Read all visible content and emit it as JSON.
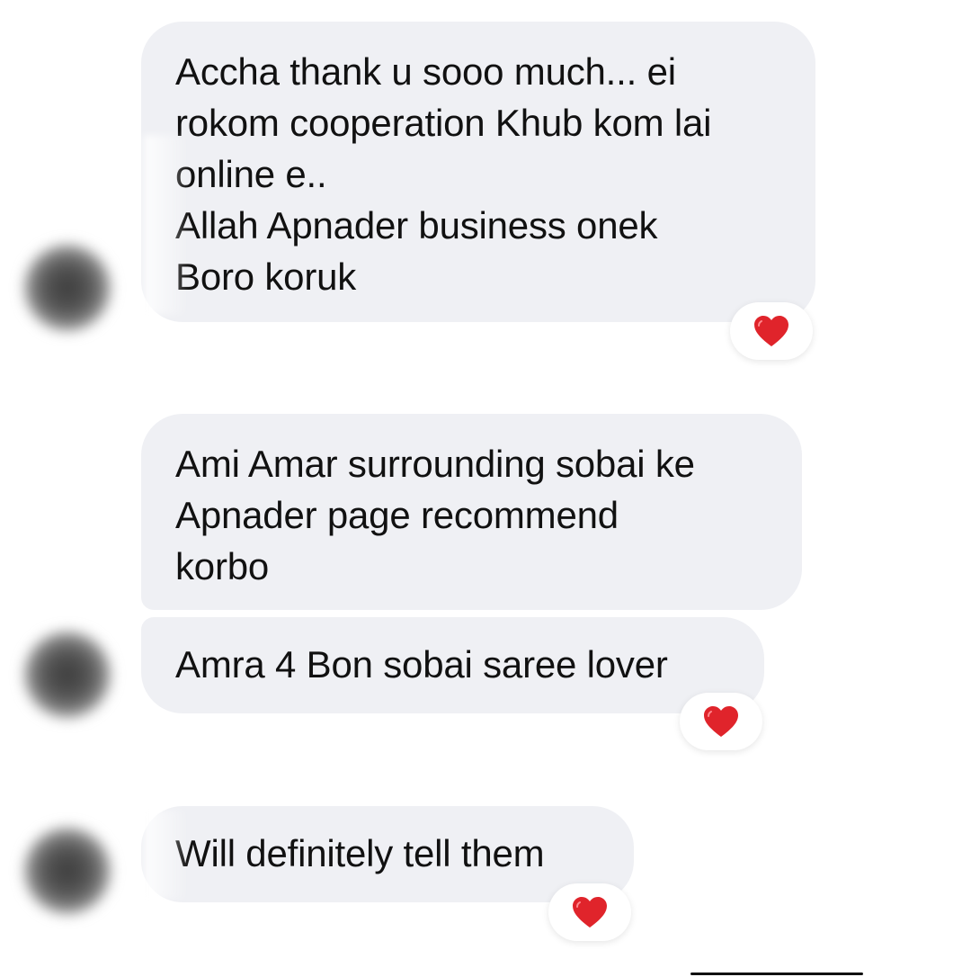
{
  "messages": [
    {
      "text": "Accha thank u sooo much... ei\nrokom cooperation Khub kom lai\nonline e..\nAllah Apnader business onek\nBoro koruk",
      "reaction": "red-heart-icon"
    },
    {
      "text": "Ami Amar surrounding sobai ke\nApnader page recommend\nkorbo",
      "reaction": null
    },
    {
      "text": "Amra 4 Bon sobai saree lover",
      "reaction": "red-heart-icon"
    },
    {
      "text": "Will definitely tell them",
      "reaction": "red-heart-icon"
    }
  ],
  "colors": {
    "bubble_background": "#eff0f4",
    "text": "#111111",
    "heart": "#e0242b"
  }
}
